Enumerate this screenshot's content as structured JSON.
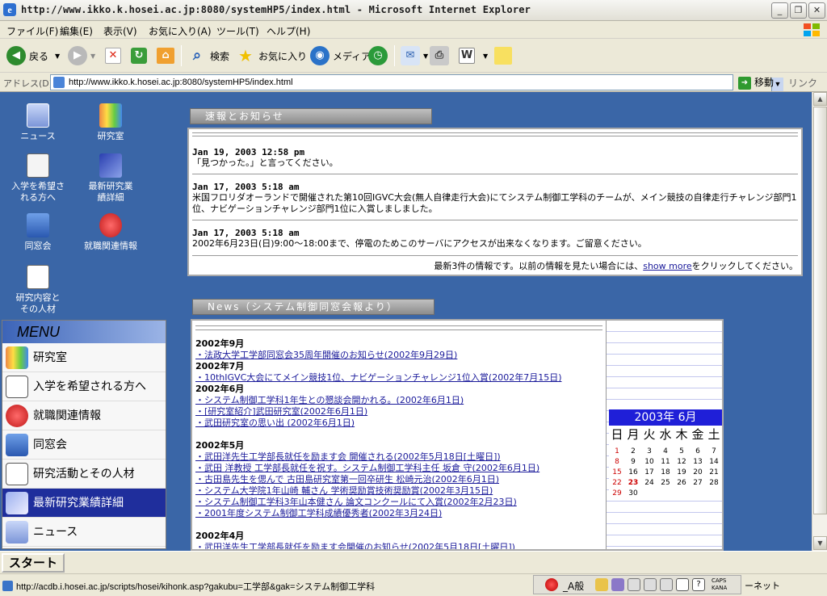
{
  "window": {
    "title": "http://www.ikko.k.hosei.ac.jp:8080/systemHP5/index.html - Microsoft Internet Explorer"
  },
  "menubar": [
    "ファイル(F)",
    "編集(E)",
    "表示(V)",
    "お気に入り(A)",
    "ツール(T)",
    "ヘルプ(H)"
  ],
  "toolbar": {
    "back": "戻る",
    "search": "検索",
    "favorites": "お気に入り",
    "media": "メディア"
  },
  "address": {
    "label": "アドレス(D)",
    "url": "http://www.ikko.k.hosei.ac.jp:8080/systemHP5/index.html",
    "go": "移動",
    "links": "リンク"
  },
  "desktop_icons": [
    {
      "label": "ニュース"
    },
    {
      "label": "研究室"
    },
    {
      "label": "入学を希望される方へ"
    },
    {
      "label": "最新研究業績詳細"
    },
    {
      "label": "同窓会"
    },
    {
      "label": "就職関連情報"
    },
    {
      "label": "研究内容とその人材"
    }
  ],
  "menu": {
    "header": "MENU",
    "items": [
      {
        "label": "研究室"
      },
      {
        "label": "入学を希望される方へ"
      },
      {
        "label": "就職関連情報"
      },
      {
        "label": "同窓会"
      },
      {
        "label": "研究活動とその人材"
      },
      {
        "label": "最新研究業績詳細"
      },
      {
        "label": "ニュース"
      }
    ]
  },
  "news1": {
    "title": "速報とお知らせ",
    "entries": [
      {
        "time": "Jan 19, 2003 12:58 pm",
        "text": "「見つかった。」と言ってください。"
      },
      {
        "time": "Jan 17, 2003 5:18 am",
        "text": "米国フロリダオーランドで開催された第10回IGVC大会(無人自律走行大会)にてシステム制御工学科のチームが、メイン競技の自律走行チャレンジ部門1位、ナビゲーションチャレンジ部門1位に入賞しましました。"
      },
      {
        "time": "Jan 17, 2003 5:18 am",
        "text": "2002年6月23日(日)9:00～18:00まで、停電のためこのサーバにアクセスが出来なくなります。ご留意ください。"
      }
    ],
    "footer_pre": "最新3件の情報です。以前の情報を見たい場合には、",
    "footer_link": "show more",
    "footer_post": "をクリックしてください。"
  },
  "news2": {
    "title": "News（システム制御同窓会報より）",
    "groups": [
      {
        "year": "2002年9月",
        "links": [
          "法政大学工学部同窓会35周年開催のお知らせ(2002年9月29日)"
        ]
      },
      {
        "year": "2002年7月",
        "links": [
          "10thIGVC大会にてメイン競技1位、ナビゲーションチャレンジ1位入賞(2002年7月15日)"
        ]
      },
      {
        "year": "2002年6月",
        "links": [
          "システム制御工学科1年生との懇談会開かれる。(2002年6月1日)",
          "[研究室紹介]武田研究室(2002年6月1日)",
          "武田研究室の思い出 (2002年6月1日)"
        ]
      },
      {
        "year": "2002年5月",
        "links": [
          "武田洋先生工学部長就任を励ます会 開催される(2002年5月18日[土曜日])",
          "武田 洋教授 工学部長就任を祝す。システム制御工学科主任 坂倉 守(2002年6月1日)",
          "古田島先生を偲んで 古田島研究室第一回卒研生 松崎元治(2002年6月1日)",
          "システム大学院1年山崎 輔さん 学術奨励賞技術奨励賞(2002年3月15日)",
          "システム制御工学科3年山本健さん 論文コンクールにて入賞(2002年2月23日)",
          "2001年度システム制御工学科成績優秀者(2002年3月24日)"
        ]
      },
      {
        "year": "2002年4月",
        "links": [
          "武田洋先生工学部長就任を励ます会開催のお知らせ(2002年5月18日[土曜日])"
        ]
      }
    ]
  },
  "calendar": {
    "title": "2003年 6月",
    "dow": [
      "日",
      "月",
      "火",
      "水",
      "木",
      "金",
      "土"
    ],
    "weeks": [
      [
        "1",
        "2",
        "3",
        "4",
        "5",
        "6",
        "7"
      ],
      [
        "8",
        "9",
        "10",
        "11",
        "12",
        "13",
        "14"
      ],
      [
        "15",
        "16",
        "17",
        "18",
        "19",
        "20",
        "21"
      ],
      [
        "22",
        "23",
        "24",
        "25",
        "26",
        "27",
        "28"
      ],
      [
        "29",
        "30",
        "",
        "",
        "",
        "",
        ""
      ]
    ],
    "today": "23"
  },
  "taskbar": {
    "start": "スタート"
  },
  "status": {
    "text": "http://acdb.i.hosei.ac.jp/scripts/hosei/kihonk.asp?gakubu=工学部&gak=システム制御工学科",
    "ime": "般",
    "ime_prefix": "_A",
    "caps": "CAPS",
    "kana": "KANA",
    "zone": "ーネット"
  }
}
